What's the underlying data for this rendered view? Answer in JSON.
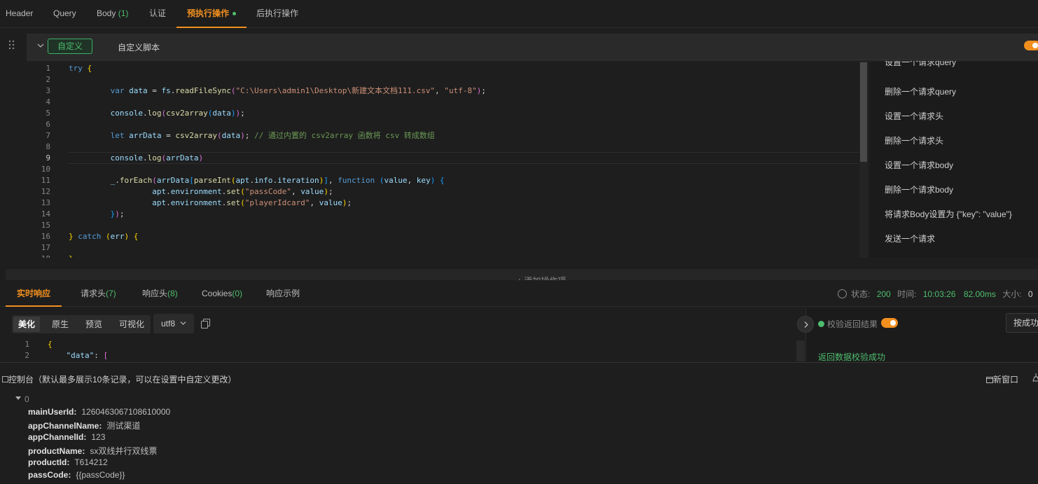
{
  "top_tabs": {
    "header": "Header",
    "query": "Query",
    "body_label": "Body",
    "body_count": "(1)",
    "auth": "认证",
    "pre_exec": "预执行操作",
    "post_exec": "后执行操作"
  },
  "script_header": {
    "custom_btn": "自定义",
    "custom_script": "自定义脚本"
  },
  "editor": {
    "line_numbers": [
      "1",
      "2",
      "3",
      "4",
      "5",
      "6",
      "7",
      "8",
      "9",
      "10",
      "11",
      "12",
      "13",
      "14",
      "15",
      "16",
      "17",
      "18"
    ],
    "code": [
      "try {",
      "",
      "    var data = fs.readFileSync(\"C:\\Users\\admin1\\Desktop\\新建文本文档111.csv\", \"utf-8\");",
      "",
      "    console.log(csv2array(data));",
      "",
      "    let arrData = csv2array(data); // 通过内置的 csv2array 函数将 csv 转成数组",
      "",
      "    console.log(arrData)",
      "",
      "    _.forEach(arrData[parseInt(apt.info.iteration)], function (value, key) {",
      "        apt.environment.set(\"passCode\", value);",
      "        apt.environment.set(\"playerIdcard\", value);",
      "    });",
      "",
      "} catch (err) {",
      "",
      "}"
    ]
  },
  "snippets": [
    "设置一个请求query",
    "删除一个请求query",
    "设置一个请求头",
    "删除一个请求头",
    "设置一个请求body",
    "删除一个请求body",
    "将请求Body设置为 {\"key\": \"value\"}",
    "发送一个请求"
  ],
  "add_bar": "+ 添加操作项",
  "response_tabs": {
    "realtime": "实时响应",
    "req_headers_label": "请求头",
    "req_headers_count": "(7)",
    "resp_headers_label": "响应头",
    "resp_headers_count": "(8)",
    "cookies_label": "Cookies",
    "cookies_count": "(0)",
    "examples": "响应示例"
  },
  "status": {
    "status_label": "状态:",
    "status_value": "200",
    "time_label": "时间:",
    "time_value": "10:03:26",
    "duration": "82.00ms",
    "size_label": "大小:",
    "size_value": "0"
  },
  "view_modes": {
    "pretty": "美化",
    "raw": "原生",
    "preview": "预览",
    "visual": "可视化",
    "encoding": "utf8"
  },
  "response_body": {
    "line_numbers": [
      "1",
      "2"
    ],
    "lines": [
      "{",
      "    \"data\": ["
    ]
  },
  "validation": {
    "label": "校验返回结果",
    "by_success": "按成功",
    "result": "返回数据校验成功"
  },
  "console": {
    "title": "控制台（默认最多展示10条记录，可以在设置中自定义更改）",
    "new_window": "新窗口",
    "index": "0",
    "entries": [
      {
        "key": "mainUserId:",
        "value": "1260463067108610000"
      },
      {
        "key": "appChannelName:",
        "value": "测试渠道"
      },
      {
        "key": "appChannelId:",
        "value": "123"
      },
      {
        "key": "productName:",
        "value": "sx双线并行双线票"
      },
      {
        "key": "productId:",
        "value": "T614212"
      },
      {
        "key": "passCode:",
        "value": "{{passCode}}"
      }
    ]
  },
  "colors": {
    "accent": "#f08f1e",
    "success": "#4ebd6e",
    "background": "#1e1e1e"
  }
}
